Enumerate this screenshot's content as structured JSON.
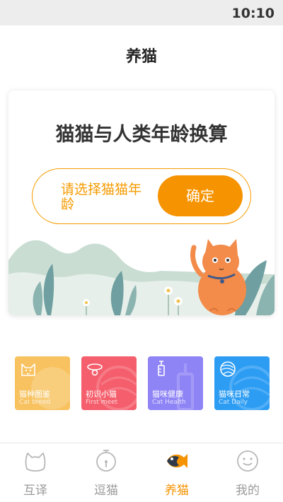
{
  "status_bar": {
    "time": "10:10"
  },
  "nav": {
    "title": "养猫"
  },
  "calculator": {
    "title": "猫猫与人类年龄换算",
    "picker_placeholder": "请选择猫猫年龄",
    "confirm_label": "确定"
  },
  "features": [
    {
      "title": "猫种图鉴",
      "subtitle": "Cat breed",
      "icon": "cat-face-icon",
      "color": "#f7c25f"
    },
    {
      "title": "初识小猫",
      "subtitle": "First meet",
      "icon": "cat-collar-icon",
      "color": "#f55e6c"
    },
    {
      "title": "猫咪健康",
      "subtitle": "Cat Health",
      "icon": "syringe-icon",
      "color": "#8f84f6"
    },
    {
      "title": "猫咪日常",
      "subtitle": "Cat Daily",
      "icon": "yarn-ball-icon",
      "color": "#2d9df4"
    }
  ],
  "tabs": [
    {
      "label": "互译",
      "icon": "cat-head-icon",
      "active": false
    },
    {
      "label": "逗猫",
      "icon": "cat-toy-icon",
      "active": false
    },
    {
      "label": "养猫",
      "icon": "fish-icon",
      "active": true
    },
    {
      "label": "我的",
      "icon": "smiley-icon",
      "active": false
    }
  ],
  "colors": {
    "accent": "#f59300",
    "inactive_tab": "#9a9a9a"
  }
}
